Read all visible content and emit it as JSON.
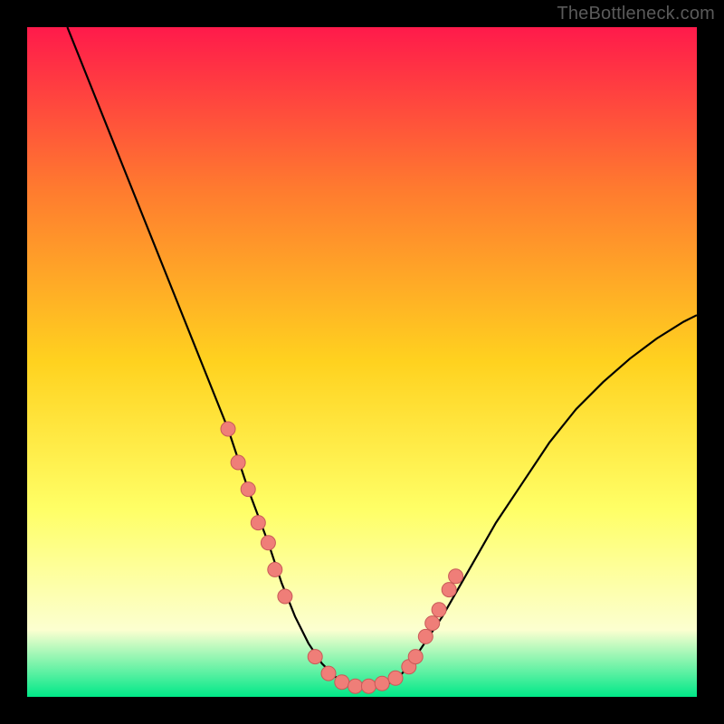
{
  "watermark": "TheBottleneck.com",
  "colors": {
    "frame": "#000000",
    "gradient_top": "#ff1a4b",
    "gradient_upper_mid": "#ff7a2f",
    "gradient_mid": "#ffd21f",
    "gradient_lower_mid": "#ffff66",
    "gradient_low": "#fcffd0",
    "gradient_bottom": "#00e888",
    "curve": "#000000",
    "dot_fill": "#ef7e78",
    "dot_stroke": "#c85a58"
  },
  "chart_data": {
    "type": "line",
    "title": "",
    "xlabel": "",
    "ylabel": "",
    "xlim": [
      0,
      100
    ],
    "ylim": [
      0,
      100
    ],
    "grid": false,
    "legend": false,
    "series": [
      {
        "name": "bottleneck-curve",
        "x": [
          6,
          10,
          14,
          18,
          22,
          26,
          30,
          33,
          36,
          38,
          40,
          42,
          44,
          46,
          48,
          50,
          52,
          54,
          56,
          58,
          62,
          66,
          70,
          74,
          78,
          82,
          86,
          90,
          94,
          98,
          100
        ],
        "y": [
          100,
          90,
          80,
          70,
          60,
          50,
          40,
          31,
          23,
          17,
          12,
          8,
          5,
          3,
          2,
          1.5,
          1.5,
          2,
          3.5,
          6,
          12,
          19,
          26,
          32,
          38,
          43,
          47,
          50.5,
          53.5,
          56,
          57
        ]
      }
    ],
    "points": [
      {
        "name": "left-cluster",
        "data": [
          {
            "x": 30,
            "y": 40
          },
          {
            "x": 31.5,
            "y": 35
          },
          {
            "x": 33,
            "y": 31
          },
          {
            "x": 34.5,
            "y": 26
          },
          {
            "x": 36,
            "y": 23
          },
          {
            "x": 37,
            "y": 19
          },
          {
            "x": 38.5,
            "y": 15
          }
        ]
      },
      {
        "name": "bottom-cluster",
        "data": [
          {
            "x": 43,
            "y": 6
          },
          {
            "x": 45,
            "y": 3.5
          },
          {
            "x": 47,
            "y": 2.2
          },
          {
            "x": 49,
            "y": 1.6
          },
          {
            "x": 51,
            "y": 1.6
          },
          {
            "x": 53,
            "y": 2
          },
          {
            "x": 55,
            "y": 2.8
          },
          {
            "x": 57,
            "y": 4.5
          }
        ]
      },
      {
        "name": "right-cluster",
        "data": [
          {
            "x": 58,
            "y": 6
          },
          {
            "x": 59.5,
            "y": 9
          },
          {
            "x": 60.5,
            "y": 11
          },
          {
            "x": 61.5,
            "y": 13
          },
          {
            "x": 63,
            "y": 16
          },
          {
            "x": 64,
            "y": 18
          }
        ]
      }
    ]
  }
}
